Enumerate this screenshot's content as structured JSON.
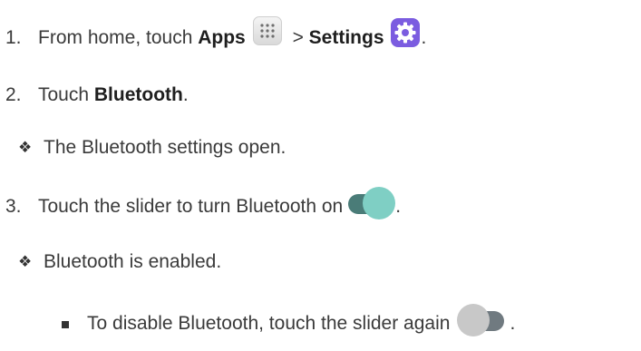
{
  "steps": [
    {
      "number": "1.",
      "text_before": "From home, touch ",
      "bold1": "Apps",
      "separator": " > ",
      "bold2": "Settings",
      "text_after": "."
    },
    {
      "number": "2.",
      "text_before": "Touch ",
      "bold1": "Bluetooth",
      "text_after": "."
    },
    {
      "bullet_symbol": "❖",
      "text": "The Bluetooth settings open."
    },
    {
      "number": "3.",
      "text_before": "Touch the slider to turn Bluetooth on",
      "text_after": "."
    },
    {
      "bullet_symbol": "❖",
      "text": "Bluetooth is enabled."
    },
    {
      "text_before": "To disable Bluetooth, touch the slider again",
      "text_after": "."
    }
  ],
  "icons": {
    "apps": "apps-grid-icon",
    "settings": "settings-gear-icon",
    "toggle_on": "toggle-on-icon",
    "toggle_off": "toggle-off-icon"
  },
  "colors": {
    "settings_icon_bg": "#7b5ce0",
    "toggle_on_track": "#4a7c78",
    "toggle_on_knob": "#7fcfc4",
    "toggle_off_track": "#707a80",
    "toggle_off_knob": "#c8c8c8"
  }
}
